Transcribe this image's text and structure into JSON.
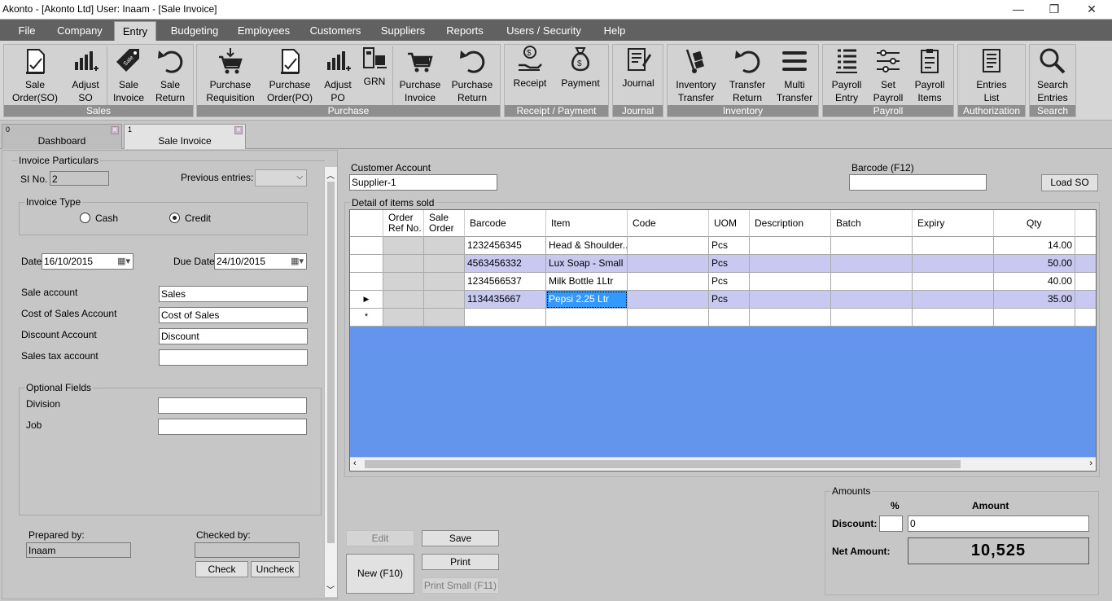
{
  "window": {
    "title": "Akonto - [Akonto Ltd]  User: Inaam - [Sale Invoice]",
    "min": "—",
    "restore": "❐",
    "close": "✕"
  },
  "menu": [
    "File",
    "Company",
    "Entry",
    "Budgeting",
    "Employees",
    "Customers",
    "Suppliers",
    "Reports",
    "Users / Security",
    "Help"
  ],
  "ribbon": {
    "sales": {
      "caption": "Sales",
      "buttons": [
        "Sale\nOrder(SO)",
        "Adjust\nSO",
        "Sale\nInvoice",
        "Sale\nReturn"
      ]
    },
    "purchase": {
      "caption": "Purchase",
      "buttons": [
        "Purchase\nRequisition",
        "Purchase\nOrder(PO)",
        "Adjust\nPO",
        "GRN",
        "Purchase\nInvoice",
        "Purchase\nReturn"
      ]
    },
    "receipt": {
      "caption": "Receipt / Payment",
      "buttons": [
        "Receipt",
        "Payment"
      ]
    },
    "journal": {
      "caption": "Journal",
      "buttons": [
        "Journal"
      ]
    },
    "inventory": {
      "caption": "Inventory",
      "buttons": [
        "Inventory\nTransfer",
        "Transfer\nReturn",
        "Multi\nTransfer"
      ]
    },
    "payroll": {
      "caption": "Payroll",
      "buttons": [
        "Payroll\nEntry",
        "Set\nPayroll",
        "Payroll\nItems"
      ]
    },
    "authorization": {
      "caption": "Authorization",
      "buttons": [
        "Entries\nList"
      ]
    },
    "search": {
      "caption": "Search",
      "buttons": [
        "Search\nEntries"
      ]
    }
  },
  "tabs": [
    {
      "num": "0",
      "name": "Dashboard"
    },
    {
      "num": "1",
      "name": "Sale Invoice"
    }
  ],
  "left": {
    "invoice_particulars": "Invoice Particulars",
    "si_label": "SI No.",
    "si_value": "2",
    "prev_label": "Previous entries:",
    "invoice_type": "Invoice Type",
    "cash": "Cash",
    "credit": "Credit",
    "date_label": "Date",
    "date_value": "16/10/2015",
    "due_label": "Due Date",
    "due_value": "24/10/2015",
    "sale_account_label": "Sale account",
    "sale_account": "Sales",
    "cos_label": "Cost of Sales Account",
    "cos": "Cost of Sales",
    "disc_label": "Discount Account",
    "disc": "Discount",
    "tax_label": "Sales tax account",
    "tax": "",
    "optional": "Optional Fields",
    "division_label": "Division",
    "division": "",
    "job_label": "Job",
    "job": "",
    "prepared_label": "Prepared by:",
    "prepared": "Inaam",
    "checked_label": "Checked by:",
    "checked": "",
    "check_btn": "Check",
    "uncheck_btn": "Uncheck"
  },
  "customer": {
    "label": "Customer Account",
    "value": "Supplier-1"
  },
  "barcode": {
    "label": "Barcode (F12)",
    "value": ""
  },
  "load_so": "Load SO",
  "grid": {
    "caption": "Detail of items sold",
    "columns": [
      "Order\nRef No.",
      "Sale\nOrder",
      "Barcode",
      "Item",
      "Code",
      "UOM",
      "Description",
      "Batch",
      "Expiry",
      "Qty"
    ],
    "rows": [
      {
        "barcode": "1232456345",
        "item": "Head & Shoulder...",
        "uom": "Pcs",
        "qty": "14.00"
      },
      {
        "barcode": "4563456332",
        "item": "Lux Soap - Small",
        "uom": "Pcs",
        "qty": "50.00"
      },
      {
        "barcode": "1234566537",
        "item": "Milk Bottle 1Ltr",
        "uom": "Pcs",
        "qty": "40.00"
      },
      {
        "barcode": "1134435667",
        "item": "Pepsi 2.25 Ltr",
        "uom": "Pcs",
        "qty": "35.00"
      }
    ],
    "new_row_marker": "*",
    "current_marker": "▶"
  },
  "buttons": {
    "edit": "Edit",
    "save": "Save",
    "print": "Print",
    "new": "New (F10)",
    "print_small": "Print Small (F11)"
  },
  "amounts": {
    "caption": "Amounts",
    "pct": "%",
    "amount": "Amount",
    "discount_label": "Discount:",
    "discount_pct": "",
    "discount_amount": "0",
    "net_label": "Net Amount:",
    "net_value": "10,525"
  },
  "colors": {
    "menubar": "#616161",
    "grid_bg": "#6495ed",
    "alt_row": "#c8c8f0",
    "selected_cell": "#3399ff"
  }
}
